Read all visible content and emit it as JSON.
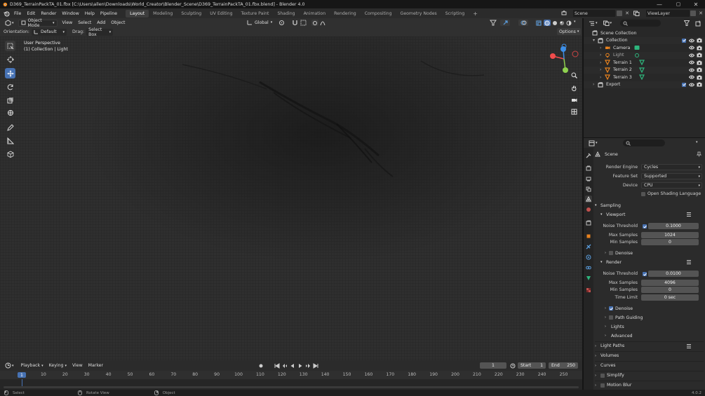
{
  "titlebar": {
    "title": "D369_TerrainPackTA_01.fbx [C:\\Users\\allen\\Downloads\\World_Creator\\Blender_Scene\\D369_TerrainPackTA_01.fbx.blend] - Blender 4.0",
    "minimize": "—",
    "maximize": "▢",
    "close": "✕"
  },
  "menubar": {
    "menus": [
      "File",
      "Edit",
      "Render",
      "Window",
      "Help",
      "Pipeline"
    ],
    "workspaces": [
      "Layout",
      "Modeling",
      "Sculpting",
      "UV Editing",
      "Texture Paint",
      "Shading",
      "Animation",
      "Rendering",
      "Compositing",
      "Geometry Nodes",
      "Scripting"
    ],
    "active_workspace": "Layout",
    "add_tab": "+",
    "scene": "Scene",
    "view_layer": "ViewLayer"
  },
  "viewport_header": {
    "mode": "Object Mode",
    "menus": [
      "View",
      "Select",
      "Add",
      "Object"
    ],
    "orientation_label": "Orientation:",
    "orientation_value": "Default",
    "drag_label": "Drag:",
    "drag_value": "Select Box",
    "transform_space": "Global",
    "options": "Options"
  },
  "viewport": {
    "view_name": "User Perspective",
    "collection_info": "(1) Collection | Light",
    "gizmo_axes": [
      "X",
      "Y",
      "Z"
    ]
  },
  "timeline": {
    "menus": [
      "Playback",
      "Keying",
      "View",
      "Marker"
    ],
    "current_frame": "1",
    "start_label": "Start",
    "start_value": "1",
    "end_label": "End",
    "end_value": "250",
    "playhead": "1",
    "ticks": [
      "10",
      "20",
      "30",
      "40",
      "50",
      "60",
      "70",
      "80",
      "90",
      "100",
      "110",
      "120",
      "130",
      "140",
      "150",
      "160",
      "170",
      "180",
      "190",
      "200",
      "210",
      "220",
      "230",
      "240",
      "250"
    ]
  },
  "statusbar": {
    "items": [
      "Select",
      "Rotate View",
      "Object"
    ],
    "version": "4.0.2"
  },
  "outliner": {
    "rows": [
      {
        "name": "Scene Collection",
        "kind": "scene"
      },
      {
        "name": "Collection",
        "kind": "collection"
      },
      {
        "name": "Camera",
        "kind": "camera"
      },
      {
        "name": "Light",
        "kind": "light"
      },
      {
        "name": "Terrain 1",
        "kind": "mesh"
      },
      {
        "name": "Terrain 2",
        "kind": "mesh"
      },
      {
        "name": "Terrain 3",
        "kind": "mesh"
      },
      {
        "name": "Export",
        "kind": "collection"
      }
    ]
  },
  "properties": {
    "context": "Scene",
    "render_engine_label": "Render Engine",
    "render_engine": "Cycles",
    "feature_set_label": "Feature Set",
    "feature_set": "Supported",
    "device_label": "Device",
    "device": "CPU",
    "osl_label": "Open Shading Language",
    "sampling": "Sampling",
    "viewport": "Viewport",
    "vp_noise_label": "Noise Threshold",
    "vp_noise": "0.1000",
    "vp_max_label": "Max Samples",
    "vp_max": "1024",
    "vp_min_label": "Min Samples",
    "vp_min": "0",
    "vp_denoise": "Denoise",
    "render": "Render",
    "r_noise_label": "Noise Threshold",
    "r_noise": "0.0100",
    "r_max_label": "Max Samples",
    "r_max": "4096",
    "r_min_label": "Min Samples",
    "r_min": "0",
    "r_time_label": "Time Limit",
    "r_time": "0 sec",
    "r_denoise": "Denoise",
    "path_guiding": "Path Guiding",
    "lights": "Lights",
    "advanced": "Advanced",
    "light_paths": "Light Paths",
    "volumes": "Volumes",
    "curves": "Curves",
    "simplify": "Simplify",
    "motion_blur": "Motion Blur"
  },
  "colors": {
    "accent": "#4772b3",
    "x_axis": "#f04c4c",
    "y_axis": "#8fd14f",
    "z_axis": "#3d8fe8"
  }
}
